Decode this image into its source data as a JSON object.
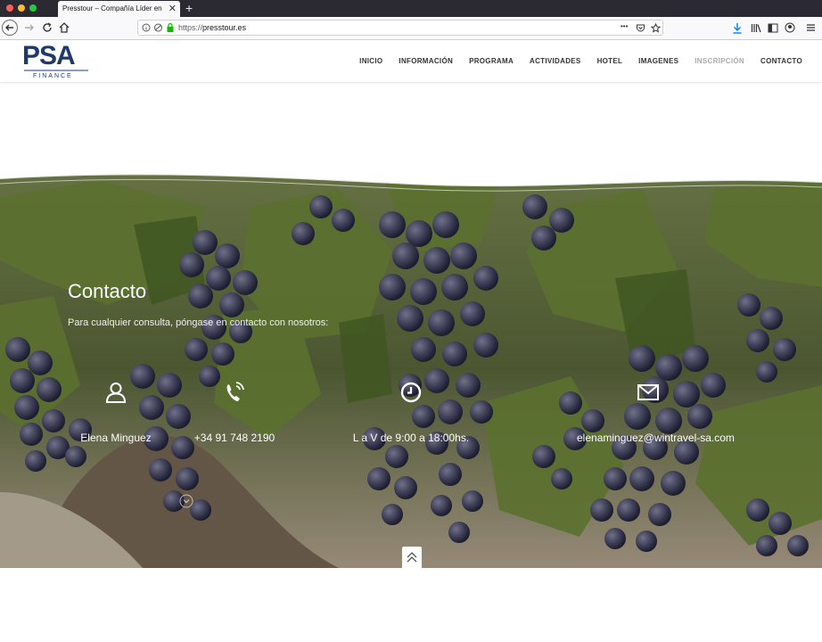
{
  "browser": {
    "tab_title": "Presstour – Compañía Líder en el sector",
    "new_tab_label": "+",
    "url_scheme": "https://",
    "url_host": "presstour.es",
    "menu_dots": "•••"
  },
  "header": {
    "logo_word": "PSA",
    "logo_sub": "FINANCE",
    "menu": [
      {
        "label": "INICIO"
      },
      {
        "label": "INFORMACIÓN"
      },
      {
        "label": "PROGRAMA"
      },
      {
        "label": "ACTIVIDADES"
      },
      {
        "label": "HOTEL"
      },
      {
        "label": "IMAGENES"
      },
      {
        "label": "INSCRIPCIÓN"
      },
      {
        "label": "CONTACTO"
      }
    ]
  },
  "hero": {
    "title": "Contacto",
    "subtitle": "Para cualquier consulta, póngase en contacto con nosotros:",
    "contacts": [
      {
        "icon": "user-icon",
        "text": "Elena Minguez"
      },
      {
        "icon": "phone-icon",
        "text": "+34 91 748 2190"
      },
      {
        "icon": "clock-icon",
        "text": "L a V de 9:00 a 18:00hs."
      },
      {
        "icon": "envelope-icon",
        "text": "elenaminguez@wintravel-sa.com"
      }
    ]
  },
  "colors": {
    "brand": "#1e3a6b",
    "menu_text": "#333333",
    "menu_muted": "#aaaaaa"
  }
}
